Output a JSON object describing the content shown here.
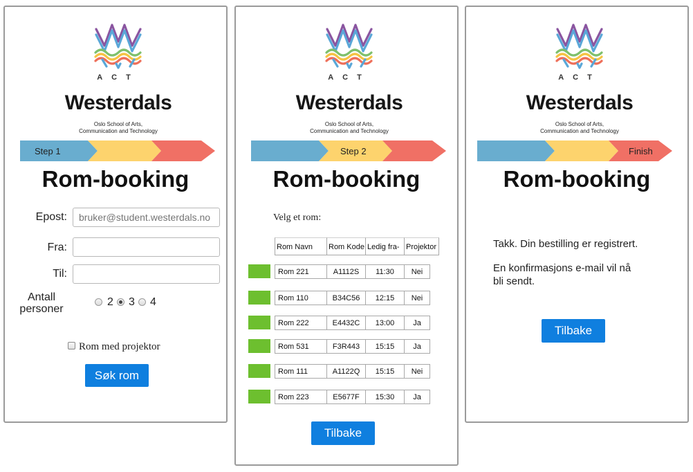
{
  "brand": {
    "name": "Westerdals",
    "tagline_line1": "Oslo School of Arts,",
    "tagline_line2": "Communication and Technology",
    "monogram": "ACT"
  },
  "colors": {
    "step_blue": "#69adcf",
    "step_yellow": "#fdd36d",
    "step_red": "#f07065",
    "accent": "#0f7fdf",
    "room_button": "#6dbf2f"
  },
  "panel1": {
    "step_label": "Step 1",
    "title": "Rom-booking",
    "email_label": "Epost:",
    "email_placeholder": "bruker@student.westerdals.no",
    "from_label": "Fra:",
    "to_label": "Til:",
    "persons_label_line1": "Antall",
    "persons_label_line2": "personer",
    "person_options": [
      "2",
      "3",
      "4"
    ],
    "person_selected": "3",
    "projector_label": "Rom med projektor",
    "search_button": "Søk rom"
  },
  "panel2": {
    "step_label": "Step 2",
    "title": "Rom-booking",
    "prompt": "Velg et rom:",
    "columns": [
      "Rom Navn",
      "Rom Kode",
      "Ledig fra-",
      "Projektor"
    ],
    "rows": [
      [
        "Rom 221",
        "A1112S",
        "11:30",
        "Nei"
      ],
      [
        "Rom 110",
        "B34C56",
        "12:15",
        "Nei"
      ],
      [
        "Rom 222",
        "E4432C",
        "13:00",
        "Ja"
      ],
      [
        "Rom 531",
        "F3R443",
        "15:15",
        "Ja"
      ],
      [
        "Rom 111",
        "A1122Q",
        "15:15",
        "Nei"
      ],
      [
        "Rom 223",
        "E5677F",
        "15:30",
        "Ja"
      ]
    ],
    "back_button": "Tilbake"
  },
  "panel3": {
    "step_label": "Finish",
    "title": "Rom-booking",
    "thanks": "Takk. Din bestilling er registrert.",
    "confirm_line1": "En konfirmasjons e-mail vil nå",
    "confirm_line2": "bli sendt.",
    "back_button": "Tilbake"
  }
}
